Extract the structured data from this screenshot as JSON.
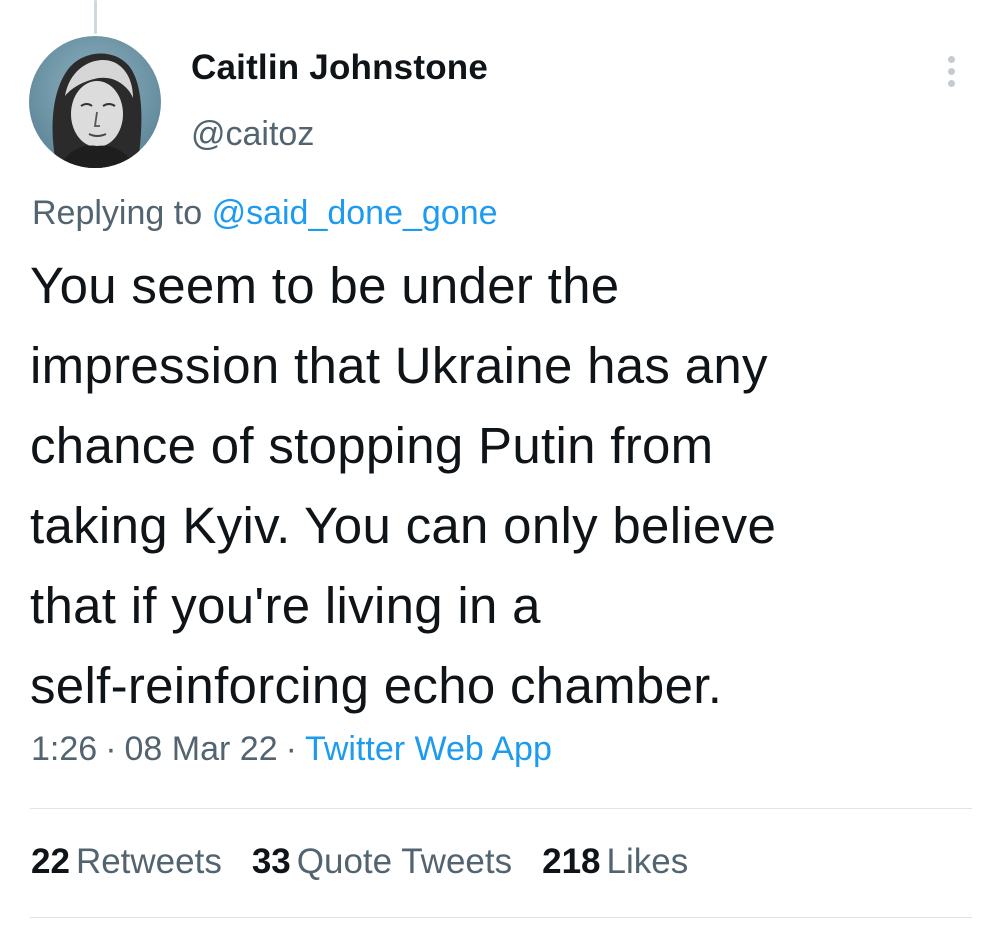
{
  "author": {
    "name": "Caitlin Johnstone",
    "handle": "@caitoz",
    "avatar_icon": "user-avatar-portrait"
  },
  "reply": {
    "prefix": "Replying to",
    "to_handle": "@said_done_gone"
  },
  "tweet": {
    "text": "You seem to be under the\nimpression that Ukraine has any\nchance of stopping Putin from\ntaking Kyiv. You can only believe\nthat if you're living in a\nself-reinforcing echo chamber."
  },
  "meta": {
    "time": "1:26",
    "date": "08 Mar 22",
    "source": "Twitter Web App",
    "separator": "·"
  },
  "stats": {
    "retweets_count": "22",
    "retweets_label": "Retweets",
    "quotes_count": "33",
    "quotes_label": "Quote Tweets",
    "likes_count": "218",
    "likes_label": "Likes"
  },
  "colors": {
    "link": "#1d9bf0",
    "secondary_text": "#536471",
    "primary_text": "#0f1419",
    "divider": "#dfe4e8"
  },
  "icons": {
    "more": "more-options-icon"
  }
}
